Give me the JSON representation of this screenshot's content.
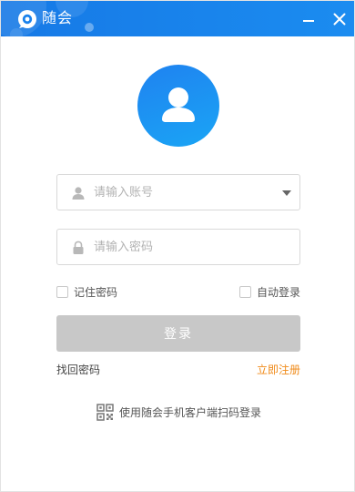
{
  "window": {
    "title": "随会"
  },
  "login": {
    "account_placeholder": "请输入账号",
    "password_placeholder": "请输入密码",
    "remember_password_label": "记住密码",
    "auto_login_label": "自动登录",
    "login_button_label": "登录",
    "forgot_password_label": "找回密码",
    "register_label": "立即注册",
    "qr_login_label": "使用随会手机客户端扫码登录"
  },
  "icons": {
    "app_logo": "app-logo-icon",
    "minimize": "minimize-icon",
    "close": "close-icon",
    "avatar": "user-avatar-icon",
    "account": "user-icon",
    "password": "lock-icon",
    "dropdown": "chevron-down-icon",
    "qr": "qr-code-icon"
  },
  "colors": {
    "titlebar": "#1a82ec",
    "avatar": "#1e8ff2",
    "login_button_disabled": "#c8c8c8",
    "register_link": "#f08a18"
  }
}
